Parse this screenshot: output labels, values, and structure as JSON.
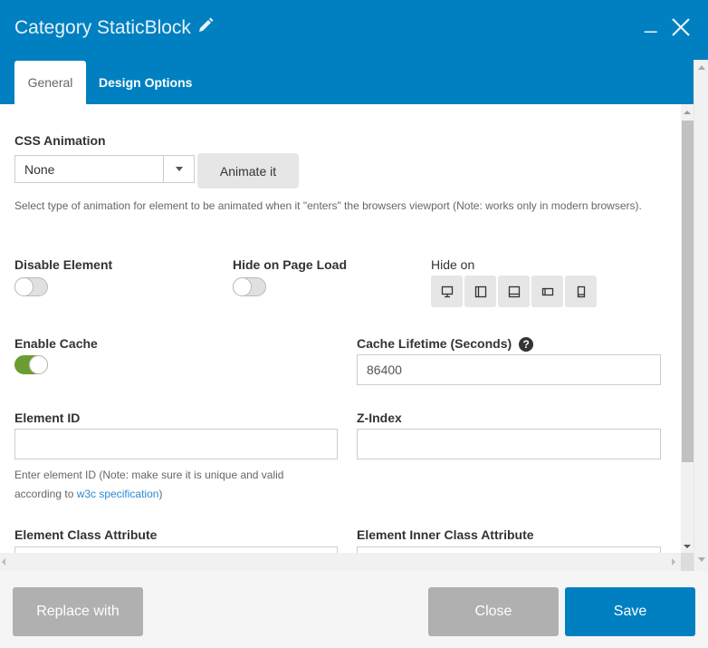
{
  "window": {
    "title": "Category StaticBlock",
    "minimize_label": "_",
    "colors": {
      "header": "#0080c0",
      "toggle_on": "#6c9d31",
      "link": "#2a8ad4"
    }
  },
  "tabs": [
    {
      "label": "General",
      "active": true
    },
    {
      "label": "Design Options",
      "active": false
    }
  ],
  "form": {
    "css_animation": {
      "label": "CSS Animation",
      "selected": "None",
      "animate_button": "Animate it",
      "help": "Select type of animation for element to be animated when it \"enters\" the browsers viewport (Note: works only in modern browsers)."
    },
    "disable_element": {
      "label": "Disable Element",
      "on": false
    },
    "hide_on_page_load": {
      "label": "Hide on Page Load",
      "on": false
    },
    "hide_on": {
      "label": "Hide on",
      "devices": [
        "desktop-icon",
        "tablet-landscape-icon",
        "tablet-portrait-icon",
        "mobile-landscape-icon",
        "mobile-portrait-icon"
      ]
    },
    "enable_cache": {
      "label": "Enable Cache",
      "on": true
    },
    "cache_lifetime": {
      "label": "Cache Lifetime (Seconds)",
      "value": "86400",
      "help_icon": "?"
    },
    "element_id": {
      "label": "Element ID",
      "value": "",
      "help_prefix": "Enter element ID (Note: make sure it is unique and valid according to ",
      "help_link": "w3c specification",
      "help_suffix": ")"
    },
    "z_index": {
      "label": "Z-Index",
      "value": ""
    },
    "element_class": {
      "label": "Element Class Attribute",
      "value": ""
    },
    "element_inner_class": {
      "label": "Element Inner Class Attribute",
      "value": ""
    }
  },
  "footer": {
    "replace_label": "Replace with",
    "close_label": "Close",
    "save_label": "Save"
  }
}
